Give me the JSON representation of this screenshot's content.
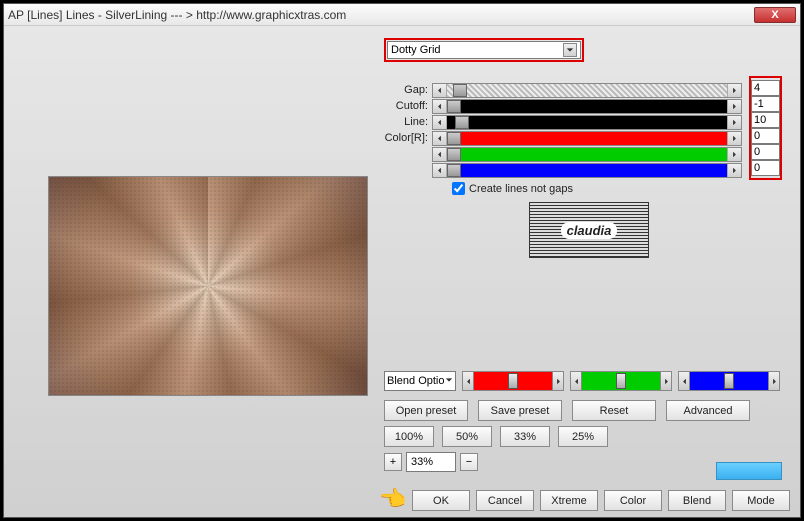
{
  "titlebar": {
    "title": "AP [Lines]  Lines - SilverLining    --- >  http://www.graphicxtras.com",
    "close_label": "X"
  },
  "preset_dropdown": {
    "selected": "Dotty Grid"
  },
  "sliders": {
    "gap": {
      "label": "Gap:",
      "value": "4",
      "thumb_pct": 2,
      "fill": "#bdbdbd"
    },
    "cutoff": {
      "label": "Cutoff:",
      "value": "-1",
      "thumb_pct": 0,
      "fill": "#000000"
    },
    "line": {
      "label": "Line:",
      "value": "10",
      "thumb_pct": 3,
      "fill": "#000000"
    },
    "color_r": {
      "label": "Color[R]:",
      "value": "0",
      "thumb_pct": 0,
      "fill": "#ff0000"
    },
    "color_g": {
      "label": "",
      "value": "0",
      "thumb_pct": 0,
      "fill": "#00cc00"
    },
    "color_b": {
      "label": "",
      "value": "0",
      "thumb_pct": 0,
      "fill": "#0000ff"
    }
  },
  "checkbox": {
    "label": "Create lines not gaps",
    "checked": true
  },
  "logo": {
    "text": "claudia"
  },
  "blend": {
    "dropdown": "Blend Optio",
    "red": {
      "color": "#ff0000"
    },
    "green": {
      "color": "#00cc00"
    },
    "blue": {
      "color": "#0000ff"
    }
  },
  "buttons": {
    "open_preset": "Open preset",
    "save_preset": "Save preset",
    "reset": "Reset",
    "advanced": "Advanced",
    "z100": "100%",
    "z50": "50%",
    "z33": "33%",
    "z25": "25%",
    "zoom_in": "+",
    "zoom_out": "−",
    "zoom_value": "33%",
    "ok": "OK",
    "cancel": "Cancel",
    "xtreme": "Xtreme",
    "color": "Color",
    "blend": "Blend",
    "mode": "Mode"
  }
}
